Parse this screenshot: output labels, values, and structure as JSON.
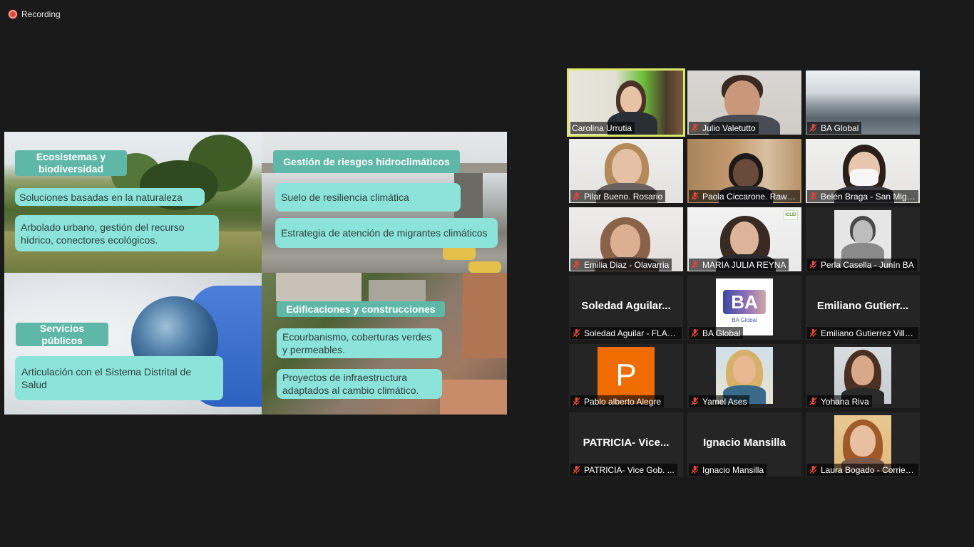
{
  "recording": {
    "label": "Recording",
    "color": "#e0463a"
  },
  "slide": {
    "q1": {
      "title": "Ecosistemas y biodiversidad",
      "items": [
        "Soluciones basadas en la naturaleza",
        "Arbolado urbano, gestión del recurso hídrico, conectores ecológicos."
      ]
    },
    "q2": {
      "title": "Gestión de riesgos hidroclimáticos",
      "items": [
        "Suelo de resiliencia climática",
        "Estrategia de atención de migrantes climáticos"
      ]
    },
    "q3": {
      "title": "Servicios públicos",
      "items": [
        "Articulación con el Sistema Distrital de Salud"
      ]
    },
    "q4": {
      "title": "Edificaciones y construcciones",
      "items": [
        "Ecourbanismo, coberturas verdes y permeables.",
        "Proyectos de infraestructura adaptados al cambio climático."
      ]
    },
    "colors": {
      "header": "#5fb7a8",
      "box": "#8be3da"
    }
  },
  "participants": [
    {
      "name": "Carolina Urrutia",
      "muted": false,
      "active": true
    },
    {
      "name": "Julio Valetutto",
      "muted": true
    },
    {
      "name": "BA Global",
      "muted": true
    },
    {
      "name": "Pilar Bueno. Rosario",
      "muted": true
    },
    {
      "name": "Paola Ciccarone. Rawson",
      "muted": true
    },
    {
      "name": "Belén Braga - San Miguel",
      "muted": true
    },
    {
      "name": "Emilia Diaz - Olavarria",
      "muted": true
    },
    {
      "name": "MARIA JULIA REYNA",
      "muted": true,
      "badge": "ICLEI"
    },
    {
      "name": "Perla Casella - Junín BA",
      "muted": true
    },
    {
      "name": "Soledad Aguilar - FLACSO",
      "display_name": "Soledad Aguilar...",
      "muted": true
    },
    {
      "name": "BA Global",
      "muted": true,
      "logo_text": "BA",
      "logo_caption": "BA Global"
    },
    {
      "name": "Emiliano Gutierrez Villanueva",
      "display_name": "Emiliano Gutierr...",
      "muted": true
    },
    {
      "name": "Pablo alberto Alegre",
      "muted": true,
      "avatar_letter": "P",
      "avatar_color": "#ef6c00"
    },
    {
      "name": "Yamel Ases",
      "muted": true
    },
    {
      "name": "Yohana Riva",
      "muted": true
    },
    {
      "name": "PATRICIA- Vice Gob. ...",
      "display_name": "PATRICIA- Vice...",
      "muted": true
    },
    {
      "name": "Ignacio Mansilla",
      "display_name": "Ignacio Mansilla",
      "muted": true
    },
    {
      "name": "Laura Bogado - Corrientes",
      "muted": true
    }
  ]
}
